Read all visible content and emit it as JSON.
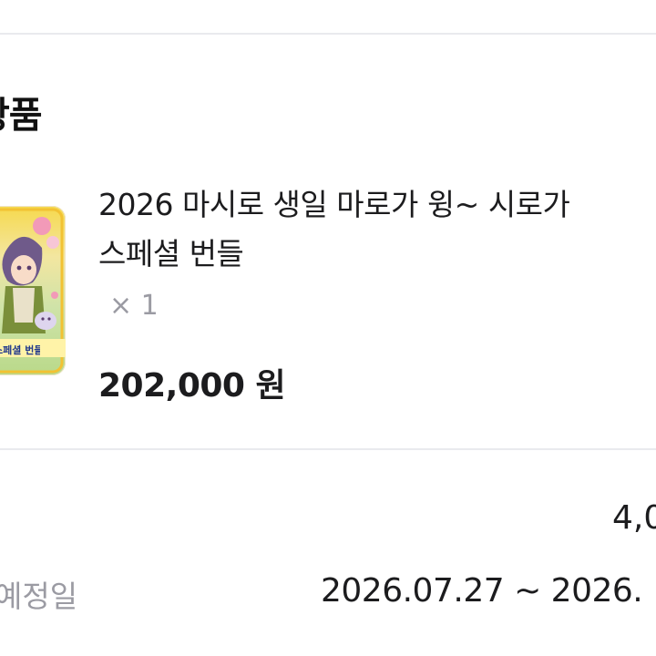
{
  "order_section": {
    "title": "상품"
  },
  "product": {
    "thumbnail_banner": "~ 스페셜 번들",
    "title_line1": "2026 마시로 생일 마로가 윙~ 시로가",
    "title_line2": "스페셜 번들",
    "quantity": "× 1",
    "price": "202,000 원"
  },
  "summary": {
    "row1_value": "4,0",
    "row2_label": "예정일",
    "row2_value": "2026.07.27 ~ 2026."
  },
  "colors": {
    "divider": "#e9eaee",
    "muted_text": "#9b9ba3",
    "main_text": "#1c1c1e"
  }
}
